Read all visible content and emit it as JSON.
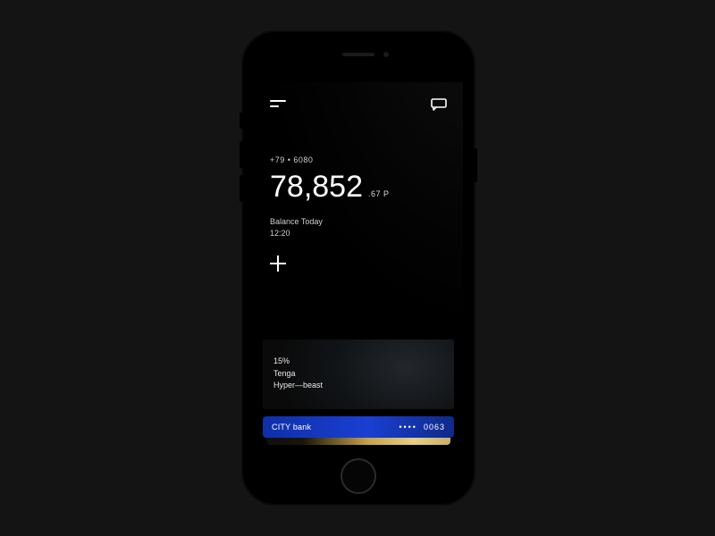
{
  "header": {
    "menu_icon": "menu-icon",
    "chat_icon": "chat-icon"
  },
  "account": {
    "number_masked": "+79  •  6080"
  },
  "balance": {
    "amount_main": "78,852",
    "amount_minor": ".67 P",
    "label": "Balance Today",
    "time": "12:20"
  },
  "actions": {
    "add_icon": "plus-icon"
  },
  "promo": {
    "percent": "15%",
    "line1": "Tenga",
    "line2": "Hyper—beast"
  },
  "cards": [
    {
      "bank": "CITY bank",
      "mask_dots": "••••",
      "last4": "0063",
      "brand_color": "#1a3fd1"
    },
    {
      "bank": "",
      "mask_dots": "",
      "last4": "",
      "brand_color": "#c7a24a"
    }
  ]
}
